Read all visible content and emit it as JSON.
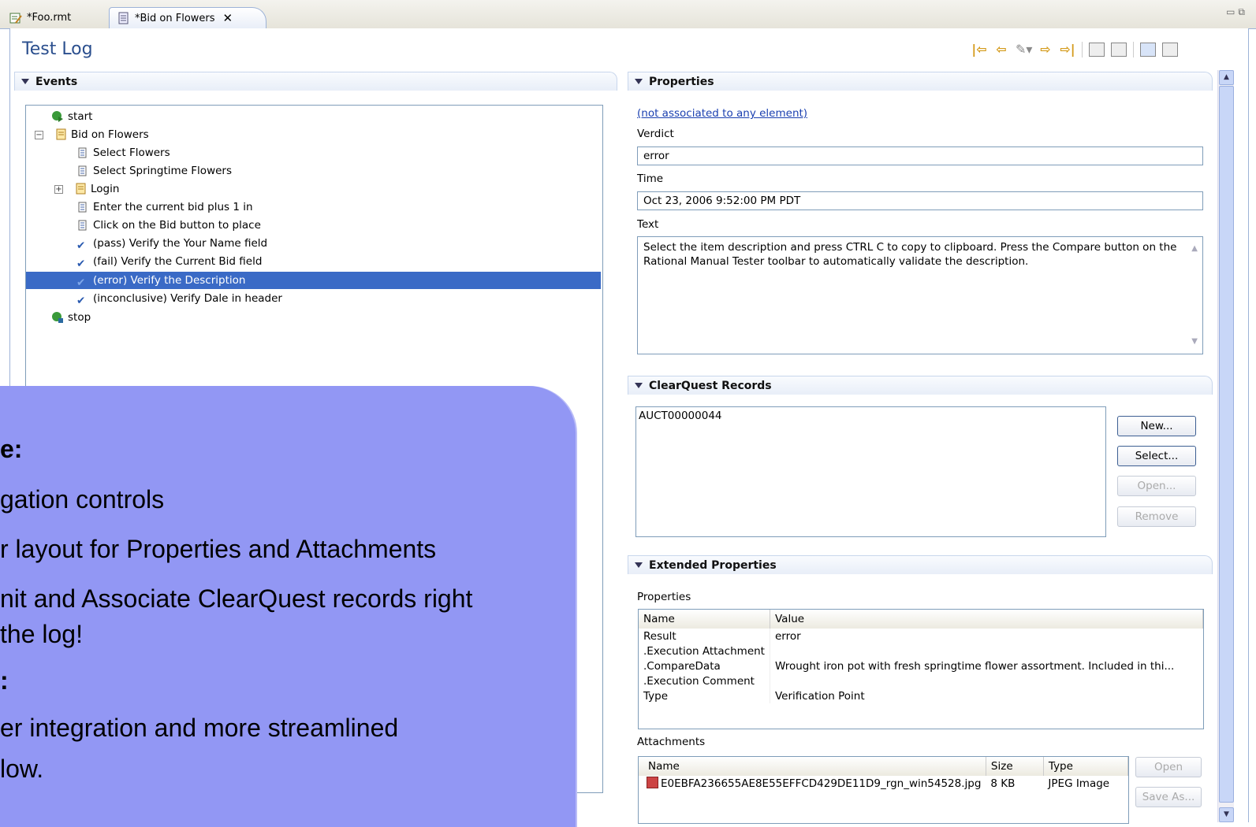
{
  "tabs": [
    {
      "label": "*Foo.rmt",
      "icon": "script-edit-icon"
    },
    {
      "label": "*Bid on Flowers",
      "icon": "document-icon",
      "active": true
    }
  ],
  "editor": {
    "title": "Test Log"
  },
  "events": {
    "header": "Events",
    "tree": [
      {
        "label": "start",
        "icon": "start-icon"
      },
      {
        "label": "Bid on Flowers",
        "icon": "folder-icon",
        "expanded": true
      },
      {
        "label": "Select Flowers",
        "icon": "step-icon"
      },
      {
        "label": "Select Springtime Flowers",
        "icon": "step-icon"
      },
      {
        "label": "Login",
        "icon": "folder-icon",
        "expanded": false
      },
      {
        "label": "Enter the current bid plus 1 in",
        "icon": "step-icon"
      },
      {
        "label": "Click on the Bid button to place",
        "icon": "step-icon"
      },
      {
        "label": "(pass) Verify the Your Name field",
        "icon": "check-icon"
      },
      {
        "label": "(fail) Verify the Current Bid field",
        "icon": "check-icon"
      },
      {
        "label": "(error) Verify the Description",
        "icon": "check-icon",
        "selected": true
      },
      {
        "label": "(inconclusive) Verify Dale in header",
        "icon": "check-icon"
      },
      {
        "label": "stop",
        "icon": "stop-icon"
      }
    ]
  },
  "properties": {
    "header": "Properties",
    "link": "(not associated to any element)",
    "verdict_label": "Verdict",
    "verdict_value": "error",
    "time_label": "Time",
    "time_value": "Oct 23, 2006 9:52:00 PM PDT",
    "text_label": "Text",
    "text_value_line1": "Select the item description and press CTRL C to copy to clipboard. Press the Compare button on the",
    "text_value_line2": "Rational Manual Tester toolbar to automatically validate the description."
  },
  "clearquest": {
    "header": "ClearQuest Records",
    "records": [
      "AUCT00000044"
    ],
    "buttons": {
      "new": "New...",
      "select": "Select...",
      "open": "Open...",
      "remove": "Remove"
    }
  },
  "extended": {
    "header": "Extended Properties",
    "properties_label": "Properties",
    "columns": [
      "Name",
      "Value"
    ],
    "rows": [
      [
        "Result",
        "error"
      ],
      [
        ".Execution Attachment",
        ""
      ],
      [
        ".CompareData",
        "Wrought iron pot with fresh springtime flower assortment. Included in thi..."
      ],
      [
        ".Execution Comment",
        ""
      ],
      [
        "Type",
        "Verification Point"
      ]
    ],
    "attachments_label": "Attachments",
    "att_columns": [
      "Name",
      "Size",
      "Type"
    ],
    "att_rows": [
      [
        "E0EBFA236655AE8E55EFFCD429DE11D9_rgn_win54528.jpg",
        "8 KB",
        "JPEG Image"
      ]
    ],
    "att_buttons": {
      "open": "Open",
      "save_as": "Save As..."
    }
  },
  "overlay": {
    "lines": [
      "e:",
      "gation controls",
      "r layout for Properties and Attachments",
      "nit and Associate ClearQuest records right",
      "the log!",
      ":",
      "er integration and more streamlined",
      "low."
    ]
  },
  "colors": {
    "accent": "#2b4f8e",
    "selection": "#3a6ac6",
    "overlay": "#9297f4"
  }
}
